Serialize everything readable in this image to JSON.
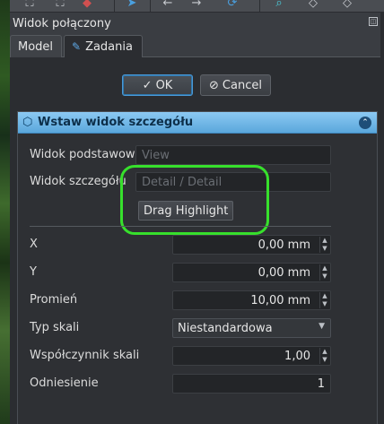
{
  "window": {
    "title": "Widok połączony",
    "undock_icon": "undock-icon"
  },
  "tabs": [
    {
      "label": "Model"
    },
    {
      "label": "Zadania",
      "icon": "pencil-icon"
    }
  ],
  "dialog_buttons": {
    "ok_label": "OK",
    "cancel_label": "Cancel"
  },
  "panel": {
    "title": "Wstaw widok szczegółu",
    "icon": "cube-icon",
    "base_view": {
      "label": "Widok podstawowy",
      "placeholder": "View"
    },
    "detail_view": {
      "label": "Widok szczegółu",
      "placeholder": "Detail / Detail"
    },
    "drag_button_label": "Drag Highlight",
    "x": {
      "label": "X",
      "value": "0,00 mm"
    },
    "y": {
      "label": "Y",
      "value": "0,00 mm"
    },
    "radius": {
      "label": "Promień",
      "value": "10,00 mm"
    },
    "scale_type": {
      "label": "Typ skali",
      "value": "Niestandardowa"
    },
    "scale_factor": {
      "label": "Współczynnik skali",
      "value": "1,00"
    },
    "reference": {
      "label": "Odniesienie",
      "value": "1"
    }
  },
  "colors": {
    "header_blue": "#6fb6e8",
    "highlight_green": "#37e02c",
    "ok_focus": "#4a9ad8"
  }
}
